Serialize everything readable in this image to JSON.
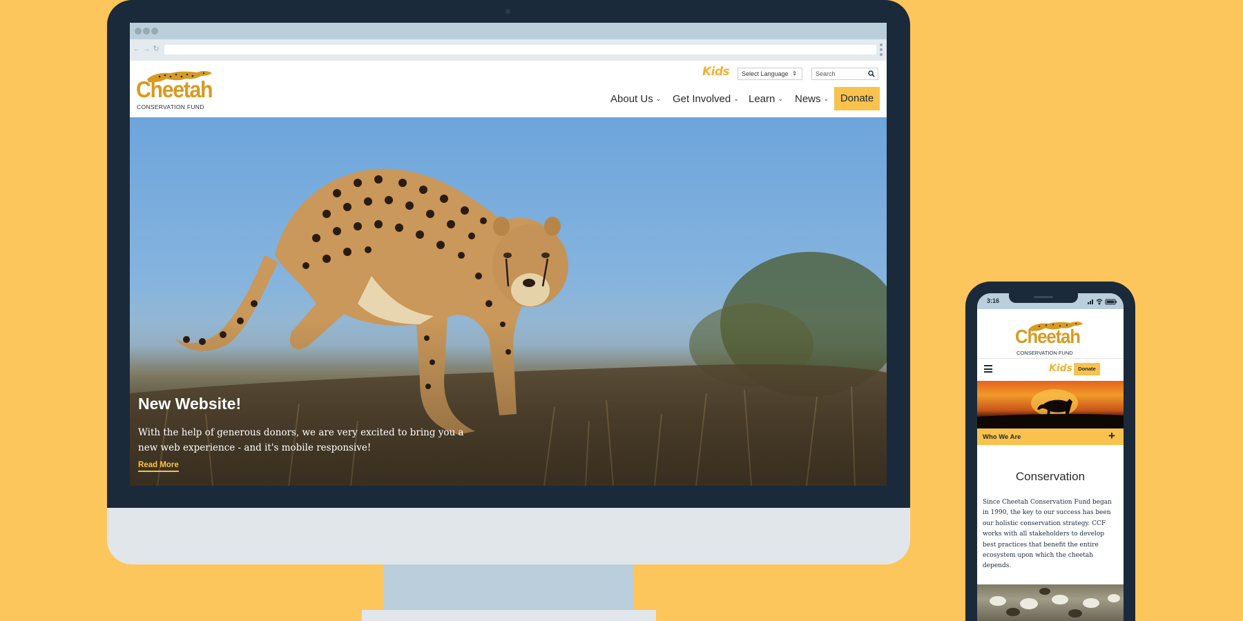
{
  "desktop": {
    "site": {
      "logo": {
        "word": "Cheetah",
        "sub": "CONSERVATION FUND"
      },
      "kids_label": "Kids",
      "language_select": "Select Language",
      "search_placeholder": "Search",
      "nav": [
        "About Us",
        "Get Involved",
        "Learn",
        "News"
      ],
      "donate_label": "Donate"
    },
    "hero": {
      "title": "New Website!",
      "text": "With the help of generous donors, we are very excited to bring you a new web experience - and it's mobile responsive!",
      "link_label": "Read More"
    }
  },
  "mobile": {
    "status_time": "3:16",
    "logo": {
      "word": "Cheetah",
      "sub": "CONSERVATION FUND"
    },
    "kids_label": "Kids",
    "donate_label": "Donate",
    "accordion_label": "Who We Are",
    "accordion_icon": "+",
    "heading": "Conservation",
    "body": "Since Cheetah Conservation Fund began in 1990, the key to our success has been our holistic conservation strategy. CCF works with all stakeholders to develop best practices that benefit the entire ecosystem upon which the cheetah depends."
  },
  "colors": {
    "background": "#FDC65C",
    "bezel": "#1B2A3A",
    "brand_gold": "#D89A21",
    "donate_yellow": "#F9C24C"
  },
  "icons": [
    "chevron-down-icon",
    "search-icon",
    "select-arrows-icon",
    "hamburger-icon",
    "plus-icon",
    "signal-icon",
    "wifi-icon",
    "battery-icon"
  ]
}
